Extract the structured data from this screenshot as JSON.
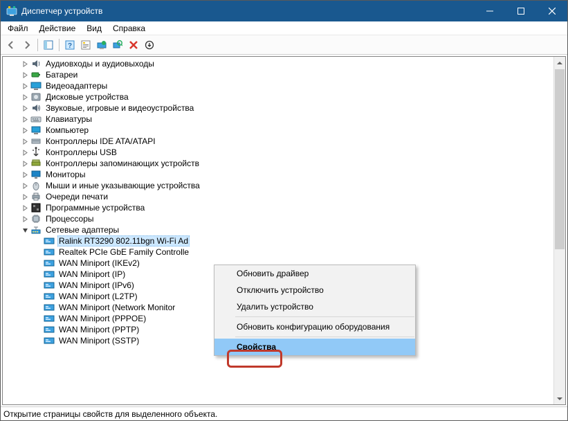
{
  "titlebar": {
    "title": "Диспетчер устройств"
  },
  "menubar": {
    "items": [
      "Файл",
      "Действие",
      "Вид",
      "Справка"
    ]
  },
  "toolbar": {
    "buttons": [
      "back",
      "forward",
      "sep",
      "show-hide",
      "sep",
      "help",
      "properties",
      "update",
      "scan",
      "uninstall",
      "enable"
    ]
  },
  "tree": {
    "categories": [
      {
        "label": "Аудиовходы и аудиовыходы",
        "icon": "audio"
      },
      {
        "label": "Батареи",
        "icon": "battery"
      },
      {
        "label": "Видеоадаптеры",
        "icon": "display-adapter"
      },
      {
        "label": "Дисковые устройства",
        "icon": "disk"
      },
      {
        "label": "Звуковые, игровые и видеоустройства",
        "icon": "sound"
      },
      {
        "label": "Клавиатуры",
        "icon": "keyboard"
      },
      {
        "label": "Компьютер",
        "icon": "computer"
      },
      {
        "label": "Контроллеры IDE ATA/ATAPI",
        "icon": "ide"
      },
      {
        "label": "Контроллеры USB",
        "icon": "usb"
      },
      {
        "label": "Контроллеры запоминающих устройств",
        "icon": "storage"
      },
      {
        "label": "Мониторы",
        "icon": "monitor"
      },
      {
        "label": "Мыши и иные указывающие устройства",
        "icon": "mouse"
      },
      {
        "label": "Очереди печати",
        "icon": "printer"
      },
      {
        "label": "Программные устройства",
        "icon": "software"
      },
      {
        "label": "Процессоры",
        "icon": "cpu"
      },
      {
        "label": "Сетевые адаптеры",
        "icon": "network",
        "expanded": true,
        "children": [
          {
            "label": "Ralink RT3290 802.11bgn Wi-Fi Ad",
            "selected": true
          },
          {
            "label": "Realtek PCIe GbE Family Controlle"
          },
          {
            "label": "WAN Miniport (IKEv2)"
          },
          {
            "label": "WAN Miniport (IP)"
          },
          {
            "label": "WAN Miniport (IPv6)"
          },
          {
            "label": "WAN Miniport (L2TP)"
          },
          {
            "label": "WAN Miniport (Network Monitor"
          },
          {
            "label": "WAN Miniport (PPPOE)"
          },
          {
            "label": "WAN Miniport (PPTP)"
          },
          {
            "label": "WAN Miniport (SSTP)"
          }
        ]
      }
    ]
  },
  "context_menu": {
    "items": [
      {
        "label": "Обновить драйвер"
      },
      {
        "label": "Отключить устройство"
      },
      {
        "label": "Удалить устройство"
      },
      {
        "sep": true
      },
      {
        "label": "Обновить конфигурацию оборудования"
      },
      {
        "sep": true
      },
      {
        "label": "Свойства",
        "bold": true,
        "hovered": true
      }
    ]
  },
  "status": {
    "text": "Открытие страницы свойств для выделенного объекта."
  }
}
